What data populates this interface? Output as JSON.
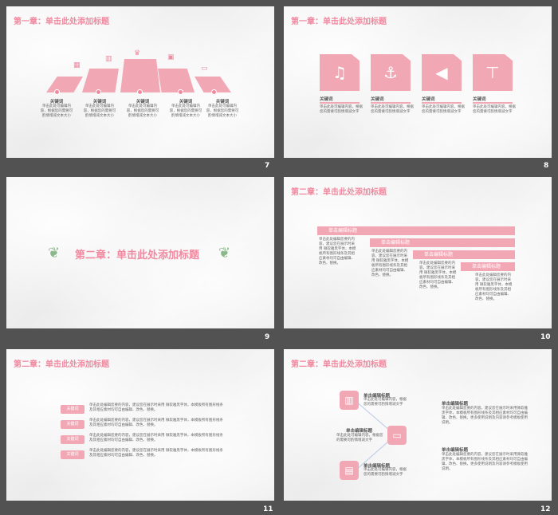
{
  "slides": [
    {
      "number": "7",
      "title": "第一章：单击此处添加标题",
      "items": [
        {
          "keyword": "关键词",
          "text": "单击此处可编辑内容，根据您的需要可酌情增减文本大小"
        },
        {
          "keyword": "关键词",
          "text": "单击此处可编辑内容，根据您的需要可酌情增减文本大小"
        },
        {
          "keyword": "关键词",
          "text": "单击此处可编辑内容，根据您的需要可酌情增减文本大小"
        },
        {
          "keyword": "关键词",
          "text": "单击此处可编辑内容，根据您的需要可酌情增减文本大小"
        },
        {
          "keyword": "关键词",
          "text": "单击此处可编辑内容，根据您的需要可酌情增减文本大小"
        }
      ],
      "steps": [
        "1",
        "2",
        "3",
        "4",
        "5"
      ]
    },
    {
      "number": "8",
      "title": "第一章：单击此处添加标题",
      "items": [
        {
          "keyword": "关键词",
          "icon": "bell-icon",
          "glyph": "🔔",
          "text": "单击此处可编辑内容，根据您的需要可酌情增减文字"
        },
        {
          "keyword": "关键词",
          "icon": "anchor-icon",
          "glyph": "⚓",
          "text": "单击此处可编辑内容，根据您的需要可酌情增减文字"
        },
        {
          "keyword": "关键词",
          "icon": "megaphone-icon",
          "glyph": "📢",
          "text": "单击此处可编辑内容，根据您的需要可酌情增减文字"
        },
        {
          "keyword": "关键词",
          "icon": "signpost-icon",
          "glyph": "🪧",
          "text": "单击此处可编辑内容，根据您的需要可酌情增减文字"
        }
      ]
    },
    {
      "number": "9",
      "title": "第二章：单击此处添加标题"
    },
    {
      "number": "10",
      "title": "第二章：单击此处添加标题",
      "bands": [
        {
          "label": "单击编辑标题",
          "text": "单击此处编辑您要的内容，建议您在展示时采用 微软雅黑字体，本模板所有图形线条及其相应素材均可自由编辑、改色、替换。"
        },
        {
          "label": "单击编辑标题",
          "text": "单击此处编辑您要的内容，建议您在展示时采用 微软雅黑字体，本模板所有图形线条及其相应素材均可自由编辑、改色、替换。"
        },
        {
          "label": "单击编辑标题",
          "text": "单击此处编辑您要的内容，建议您在展示时采用 微软雅黑字体，本模板所有图形线条及其相应素材均可自由编辑、改色、替换。"
        },
        {
          "label": "单击编辑标题",
          "text": "单击此处编辑您要的内容，建议您在展示时采用 微软雅黑字体，本模板所有图形线条及其相应素材均可自由编辑、改色、替换。"
        }
      ]
    },
    {
      "number": "11",
      "title": "第二章：单击此处添加标题",
      "rows": [
        {
          "keyword": "关键词",
          "text": "单击此处编辑您要的内容，建议您在展示时采用 微软雅黑字体，本模板所有图形线条及其相应素材均可自由编辑、改色、替换。"
        },
        {
          "keyword": "关键词",
          "text": "单击此处编辑您要的内容，建议您在展示时采用 微软雅黑字体，本模板所有图形线条及其相应素材均可自由编辑、改色、替换。"
        },
        {
          "keyword": "关键词",
          "text": "单击此处编辑您要的内容，建议您在展示时采用 微软雅黑字体，本模板所有图形线条及其相应素材均可自由编辑、改色、替换。"
        },
        {
          "keyword": "关键词",
          "text": "单击此处编辑您要的内容，建议您在展示时采用 微软雅黑字体，本模板所有图形线条及其相应素材均可自由编辑、改色、替换。"
        }
      ]
    },
    {
      "number": "12",
      "title": "第二章：单击此处添加标题",
      "nodes": [
        {
          "label": "单击编辑标题",
          "text": "单击此处可编辑内容，根据您的需要可酌情增减文字"
        },
        {
          "label": "单击编辑标题",
          "text": "单击此处可编辑内容，根据您的需要可酌情增减文字"
        },
        {
          "label": "单击编辑标题",
          "text": "单击此处可编辑内容，根据您的需要可酌情增减文字"
        }
      ],
      "right": [
        {
          "label": "单击编辑标题",
          "text": "单击此处编辑您要的内容，建议您在展示时采用微软雅黑字体，本模板所有图形线条及其相应素材均可自由编辑、改色、替换。更多使用说明及内容请参考模板使用说明。"
        },
        {
          "label": "单击编辑标题",
          "text": "单击此处编辑您要的内容，建议您在展示时采用微软雅黑字体，本模板所有图形线条及其相应素材均可自由编辑、改色、替换。更多使用说明及内容请参考模板使用说明。"
        }
      ]
    }
  ],
  "colors": {
    "accent": "#f2a7b5",
    "title": "#f08aa0",
    "background": "#525252"
  }
}
